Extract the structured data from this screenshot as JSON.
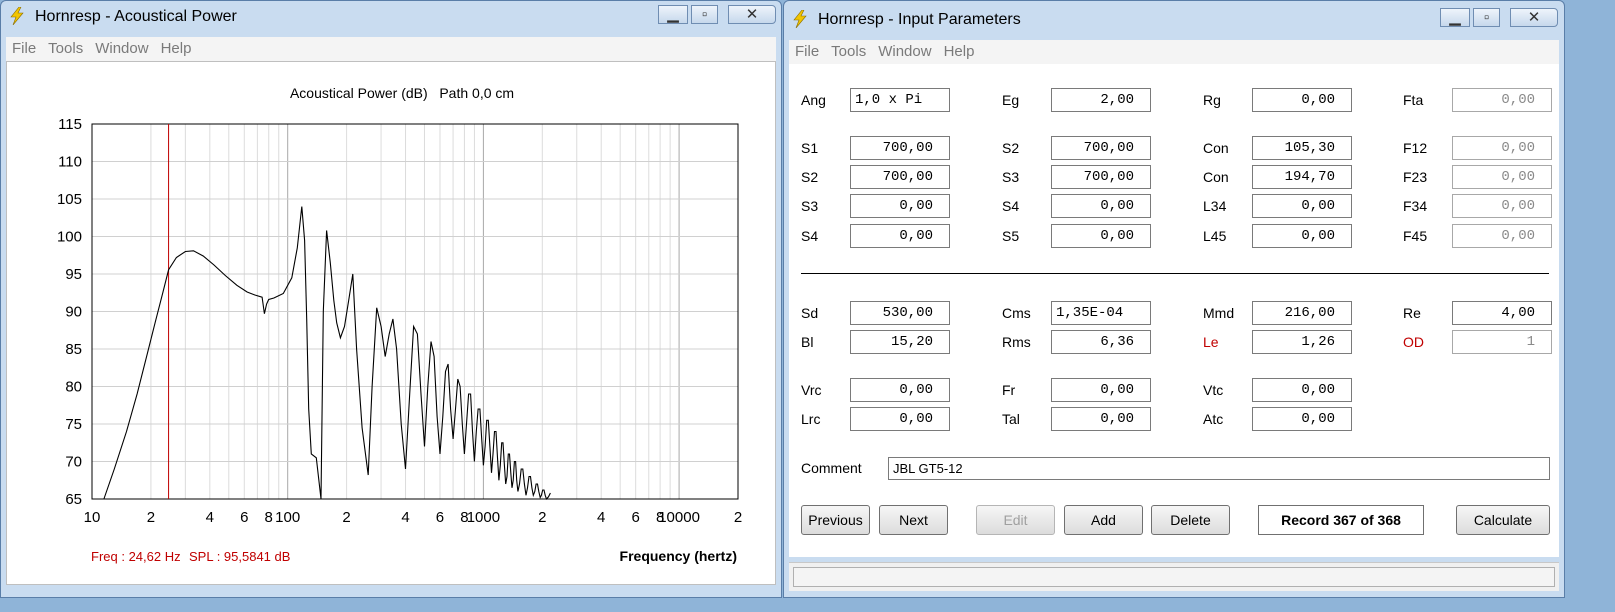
{
  "colors": {
    "accent_red": "#c00000",
    "trace": "#000000",
    "cursor": "#c00000"
  },
  "left_window": {
    "title": "Hornresp - Acoustical Power",
    "icon": "lightning-icon",
    "controls": {
      "minimize": "minimize-icon",
      "maximize": "maximize-icon",
      "close": "close-icon"
    },
    "menu": [
      "File",
      "Tools",
      "Window",
      "Help"
    ],
    "chart_data": {
      "type": "line",
      "title": "Acoustical Power (dB)   Path 0,0 cm",
      "xlabel": "Frequency (hertz)",
      "ylabel": "",
      "x_scale": "log",
      "xlim": [
        10,
        20000
      ],
      "ylim": [
        65,
        115
      ],
      "y_ticks": [
        115,
        110,
        105,
        100,
        95,
        90,
        85,
        80,
        75,
        70,
        65
      ],
      "x_tick_labels": [
        {
          "value": 10,
          "label": "10"
        },
        {
          "value": 20,
          "label": "2"
        },
        {
          "value": 40,
          "label": "4"
        },
        {
          "value": 60,
          "label": "6"
        },
        {
          "value": 80,
          "label": "8"
        },
        {
          "value": 100,
          "label": "100"
        },
        {
          "value": 200,
          "label": "2"
        },
        {
          "value": 400,
          "label": "4"
        },
        {
          "value": 600,
          "label": "6"
        },
        {
          "value": 800,
          "label": "8"
        },
        {
          "value": 1000,
          "label": "1000"
        },
        {
          "value": 2000,
          "label": "2"
        },
        {
          "value": 4000,
          "label": "4"
        },
        {
          "value": 6000,
          "label": "6"
        },
        {
          "value": 8000,
          "label": "8"
        },
        {
          "value": 10000,
          "label": "10000"
        },
        {
          "value": 20000,
          "label": "2"
        }
      ],
      "grid": true,
      "cursor_x": 24.62,
      "readout": {
        "freq": "Freq : 24,62 Hz",
        "spl": "SPL : 95,5841 dB"
      },
      "series": [
        {
          "x": [
            11.5,
            13,
            15,
            17,
            19,
            21,
            23,
            24.62,
            27,
            30,
            33,
            37,
            42,
            48,
            55,
            62,
            68,
            74,
            76,
            78,
            80,
            85,
            95,
            105,
            112,
            118,
            122,
            125,
            128,
            132,
            140,
            148,
            152,
            158,
            165,
            172,
            178,
            186,
            195,
            205,
            215,
            225,
            240,
            258,
            270,
            285,
            300,
            315,
            330,
            345,
            360,
            380,
            400,
            420,
            440,
            460,
            480,
            500,
            520,
            540,
            560,
            580,
            600,
            620,
            640,
            660,
            680,
            700,
            720,
            740,
            760,
            780,
            800,
            820,
            840,
            860,
            880,
            900,
            920,
            940,
            960,
            980,
            1000,
            1020,
            1040,
            1060,
            1080,
            1100,
            1120,
            1140,
            1160,
            1180,
            1200,
            1220,
            1240,
            1260,
            1280,
            1300,
            1320,
            1340,
            1360,
            1380,
            1400,
            1420,
            1440,
            1460,
            1480,
            1500,
            1530,
            1560,
            1590,
            1620,
            1650,
            1680,
            1710,
            1740,
            1770,
            1800,
            1830,
            1860,
            1890,
            1920,
            1950,
            1980,
            2010,
            2040,
            2070,
            2100,
            2150,
            2200
          ],
          "y": [
            65,
            69,
            74,
            79,
            84,
            88.5,
            92.5,
            95.58,
            97.2,
            98,
            98.1,
            97.4,
            96.2,
            94.8,
            93.5,
            92.6,
            92.2,
            91.9,
            89.7,
            91,
            91.6,
            91.8,
            92.4,
            94.5,
            98.5,
            104,
            99.5,
            89,
            77,
            71,
            70.5,
            64.5,
            90,
            100.8,
            96.5,
            91.5,
            88.5,
            86.5,
            88,
            91.5,
            95,
            85,
            74.5,
            68.2,
            80,
            90.5,
            88,
            84,
            87,
            89,
            85,
            75,
            69,
            79,
            88,
            87,
            79,
            72,
            80,
            86,
            84,
            76,
            71,
            76,
            82,
            83,
            77,
            73,
            77,
            81,
            80,
            75,
            71,
            75,
            79,
            79,
            74,
            70,
            74,
            77,
            77,
            73,
            69.5,
            72,
            75.5,
            75.5,
            72,
            68.5,
            71,
            74,
            74,
            70.5,
            67.5,
            69.5,
            72.5,
            72.5,
            69.5,
            67,
            68,
            71,
            71,
            68.5,
            66.5,
            67.5,
            70,
            70,
            67.5,
            66,
            67,
            69,
            69,
            67,
            65.5,
            66.5,
            68,
            68,
            66.5,
            65.5,
            66,
            67,
            67,
            66,
            65.2,
            65.5,
            66.2,
            66.2,
            65.5,
            65,
            65.3,
            65.8,
            65.5,
            65,
            65
          ]
        }
      ]
    }
  },
  "right_window": {
    "title": "Hornresp - Input Parameters",
    "icon": "lightning-icon",
    "controls": {
      "minimize": "minimize-icon",
      "maximize": "maximize-icon",
      "close": "close-icon"
    },
    "menu": [
      "File",
      "Tools",
      "Window",
      "Help"
    ],
    "params": {
      "ang": {
        "label": "Ang",
        "value": "1,0 x Pi"
      },
      "eg": {
        "label": "Eg",
        "value": "2,00"
      },
      "rg": {
        "label": "Rg",
        "value": "0,00"
      },
      "fta": {
        "label": "Fta",
        "value": "0,00"
      },
      "s1": {
        "label": "S1",
        "value": "700,00"
      },
      "s2a": {
        "label": "S2",
        "value": "700,00"
      },
      "con1": {
        "label": "Con",
        "value": "105,30"
      },
      "f12": {
        "label": "F12",
        "value": "0,00"
      },
      "s2b": {
        "label": "S2",
        "value": "700,00"
      },
      "s3a": {
        "label": "S3",
        "value": "700,00"
      },
      "con2": {
        "label": "Con",
        "value": "194,70"
      },
      "f23": {
        "label": "F23",
        "value": "0,00"
      },
      "s3b": {
        "label": "S3",
        "value": "0,00"
      },
      "s4a": {
        "label": "S4",
        "value": "0,00"
      },
      "l34": {
        "label": "L34",
        "value": "0,00"
      },
      "f34": {
        "label": "F34",
        "value": "0,00"
      },
      "s4b": {
        "label": "S4",
        "value": "0,00"
      },
      "s5": {
        "label": "S5",
        "value": "0,00"
      },
      "l45": {
        "label": "L45",
        "value": "0,00"
      },
      "f45": {
        "label": "F45",
        "value": "0,00"
      },
      "sd": {
        "label": "Sd",
        "value": "530,00"
      },
      "cms": {
        "label": "Cms",
        "value": "1,35E-04"
      },
      "mmd": {
        "label": "Mmd",
        "value": "216,00"
      },
      "re": {
        "label": "Re",
        "value": "4,00"
      },
      "bl": {
        "label": "Bl",
        "value": "15,20"
      },
      "rms": {
        "label": "Rms",
        "value": "6,36"
      },
      "le": {
        "label": "Le",
        "value": "1,26"
      },
      "od": {
        "label": "OD",
        "value": "1"
      },
      "vrc": {
        "label": "Vrc",
        "value": "0,00"
      },
      "fr": {
        "label": "Fr",
        "value": "0,00"
      },
      "vtc": {
        "label": "Vtc",
        "value": "0,00"
      },
      "lrc": {
        "label": "Lrc",
        "value": "0,00"
      },
      "tal": {
        "label": "Tal",
        "value": "0,00"
      },
      "atc": {
        "label": "Atc",
        "value": "0,00"
      }
    },
    "comment": {
      "label": "Comment",
      "value": "JBL GT5-12"
    },
    "buttons": {
      "previous": "Previous",
      "next": "Next",
      "edit": "Edit",
      "add": "Add",
      "delete": "Delete",
      "calculate": "Calculate"
    },
    "record": "Record 367 of 368"
  }
}
